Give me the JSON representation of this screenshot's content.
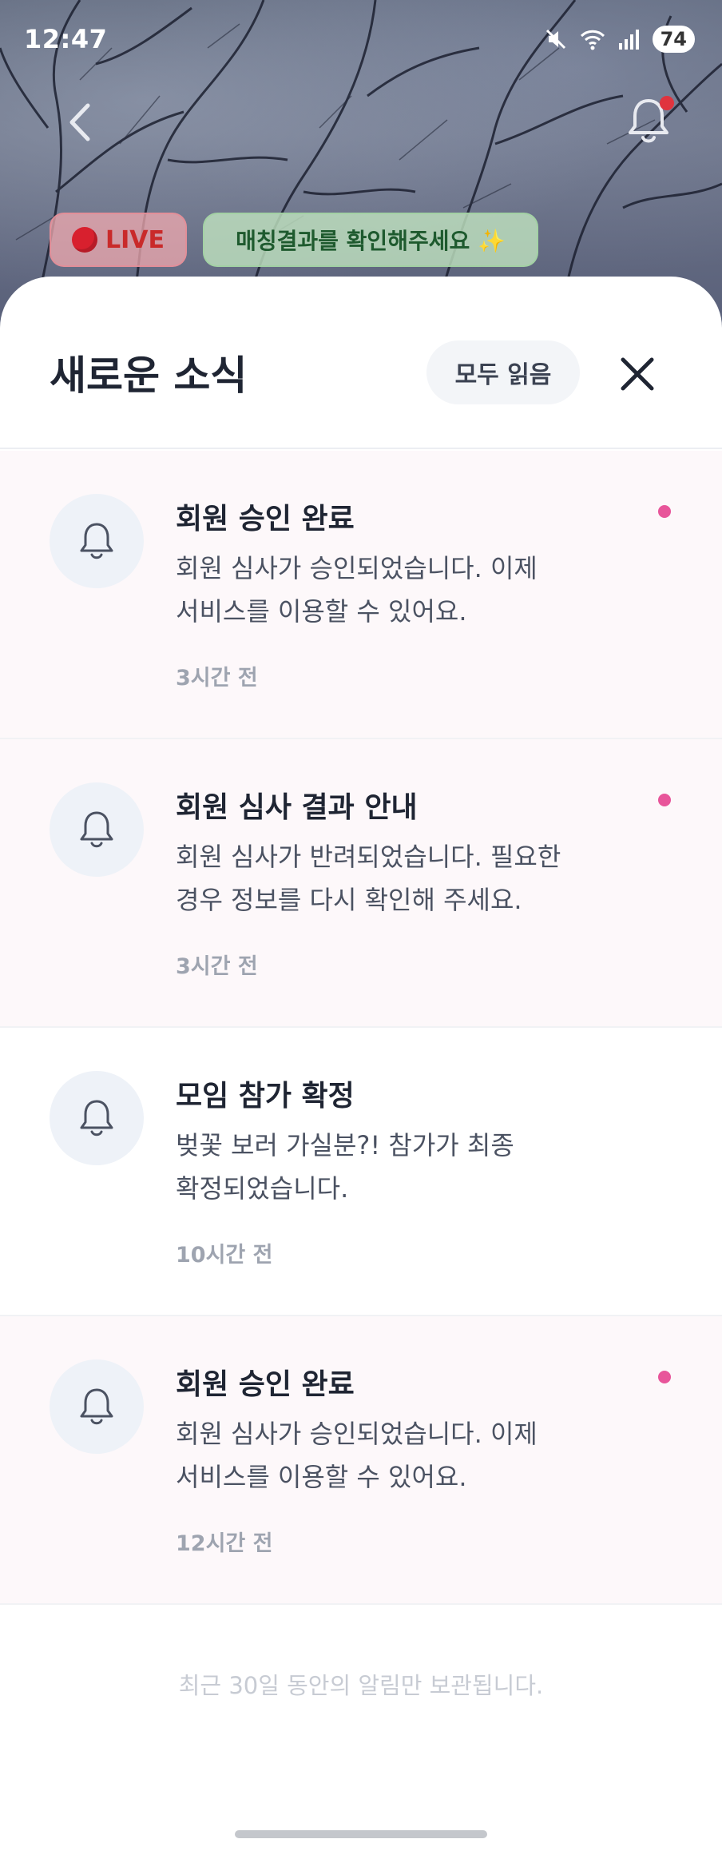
{
  "status_bar": {
    "time": "12:47",
    "battery": "74"
  },
  "top": {
    "back_icon": "chevron-left-icon",
    "bell_icon": "bell-icon",
    "live_chip": "LIVE",
    "match_chip": "매칭결과를 확인해주세요 ✨"
  },
  "sheet": {
    "title": "새로운 소식",
    "read_all_label": "모두 읽음",
    "close_icon": "close-icon"
  },
  "notifications": [
    {
      "title": "회원 승인 완료",
      "body_line1": "회원 심사가 승인되었습니다. 이제",
      "body_line2": "서비스를 이용할 수 있어요.",
      "time": "3시간 전",
      "unread": true
    },
    {
      "title": "회원 심사 결과 안내",
      "body_line1": "회원 심사가 반려되었습니다. 필요한",
      "body_line2": "경우 정보를 다시 확인해 주세요.",
      "time": "3시간 전",
      "unread": true
    },
    {
      "title": "모임 참가 확정",
      "body_line1": "벚꽃 보러 가실분?! 참가가 최종",
      "body_line2": "확정되었습니다.",
      "time": "10시간 전",
      "unread": false
    },
    {
      "title": "회원 승인 완료",
      "body_line1": "회원 심사가 승인되었습니다. 이제",
      "body_line2": "서비스를 이용할 수 있어요.",
      "time": "12시간 전",
      "unread": true
    }
  ],
  "footer_note": "최근 30일 동안의 알림만 보관됩니다.",
  "colors": {
    "unread_dot": "#e8559a",
    "unread_bg": "#fdf8fa",
    "title_text": "#1f2533",
    "live_red": "#d8202e"
  }
}
